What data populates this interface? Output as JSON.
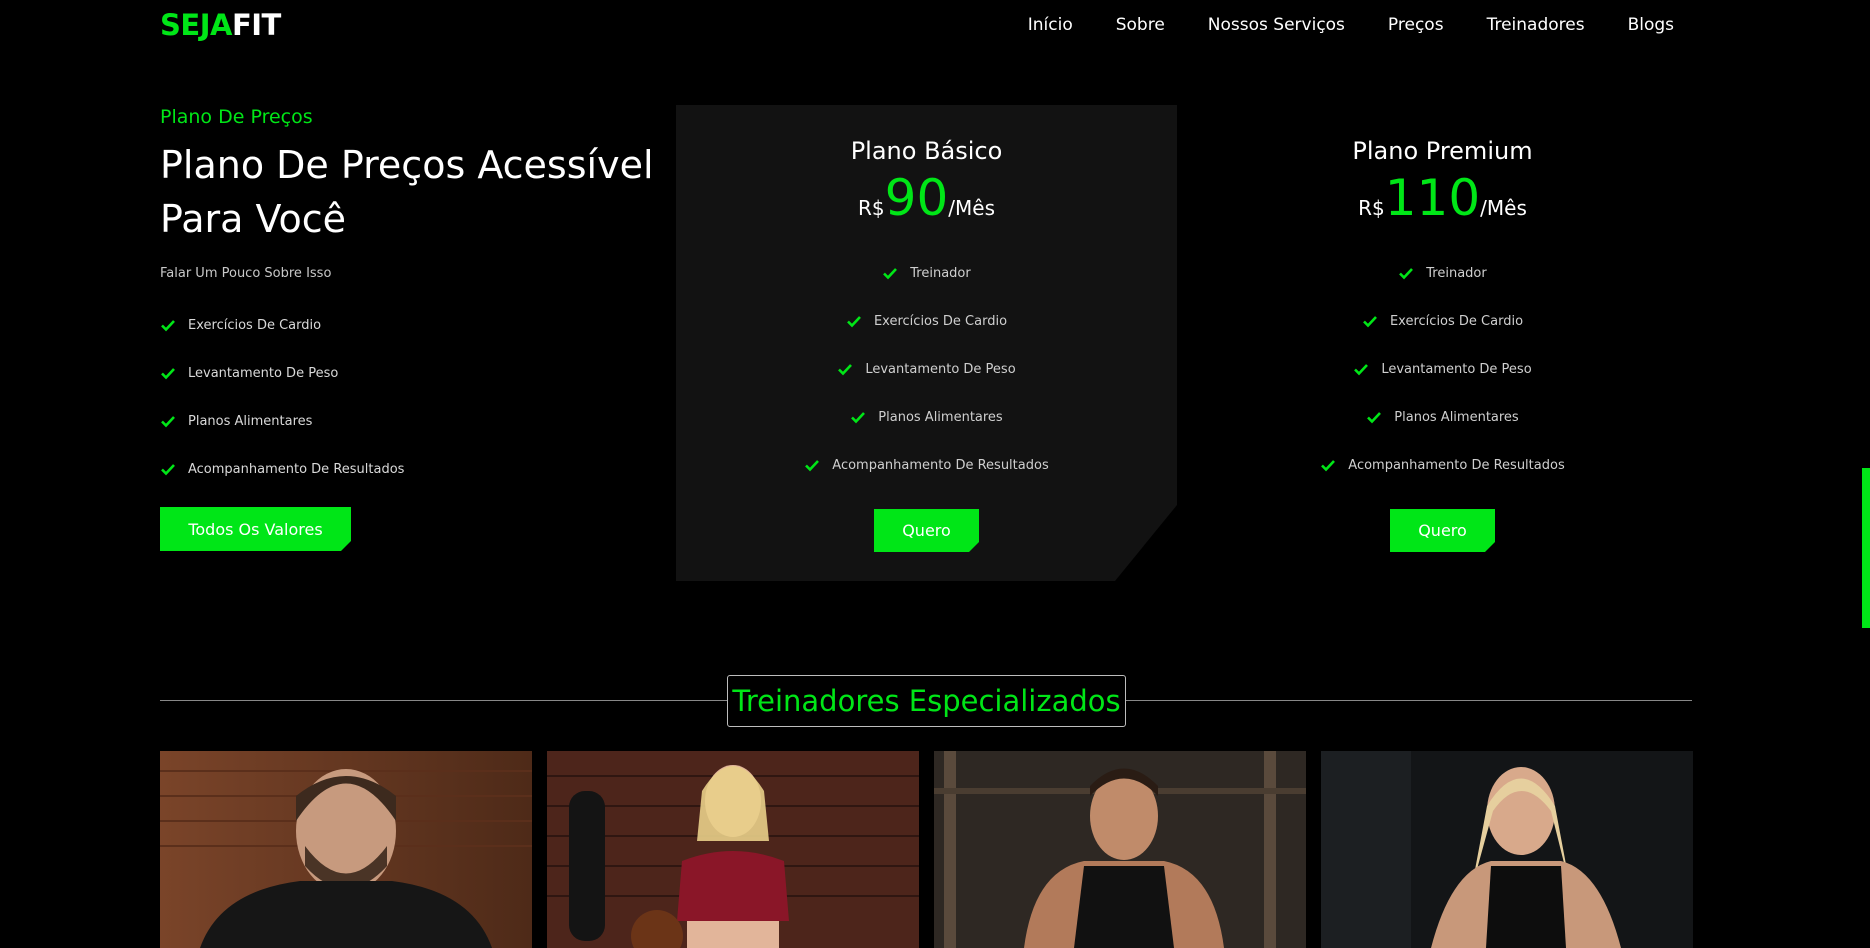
{
  "logo": {
    "part1": "SEJA",
    "part2": "FIT"
  },
  "nav": [
    "Início",
    "Sobre",
    "Nossos Serviços",
    "Preços",
    "Treinadores",
    "Blogs"
  ],
  "intro": {
    "kicker": "Plano De Preços",
    "headline_line1": "Plano De Preços Acessível",
    "headline_line2": "Para Você",
    "description": "Falar Um Pouco Sobre Isso",
    "features": [
      "Exercícios De Cardio",
      "Levantamento De Peso",
      "Planos Alimentares",
      "Acompanhamento De Resultados"
    ],
    "button": "Todos Os Valores"
  },
  "plans": [
    {
      "name": "Plano Básico",
      "currency": "R$",
      "price": "90",
      "period": "/Mês",
      "features": [
        "Treinador",
        "Exercícios De Cardio",
        "Levantamento De Peso",
        "Planos Alimentares",
        "Acompanhamento De Resultados"
      ],
      "button": "Quero"
    },
    {
      "name": "Plano Premium",
      "currency": "R$",
      "price": "110",
      "period": "/Mês",
      "features": [
        "Treinador",
        "Exercícios De Cardio",
        "Levantamento De Peso",
        "Planos Alimentares",
        "Acompanhamento De Resultados"
      ],
      "button": "Quero"
    }
  ],
  "trainers_section": {
    "title": "Treinadores Especializados"
  },
  "colors": {
    "accent": "#00e617",
    "background": "#000000",
    "card": "#121212"
  },
  "icons": {
    "feature": "check-icon"
  }
}
